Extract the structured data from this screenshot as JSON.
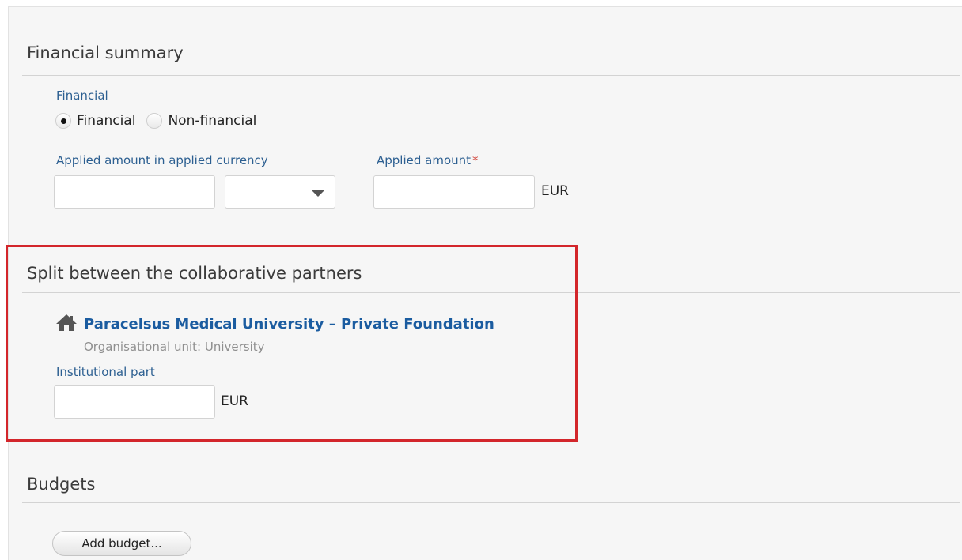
{
  "financial_summary": {
    "title": "Financial summary",
    "financial_label": "Financial",
    "radio_options": [
      {
        "label": "Financial",
        "selected": true
      },
      {
        "label": "Non-financial",
        "selected": false
      }
    ],
    "applied_currency_label": "Applied amount in applied currency",
    "applied_currency_value": "",
    "currency_select_value": "",
    "applied_amount_label": "Applied amount",
    "required_marker": "*",
    "applied_amount_value": "",
    "applied_amount_unit": "EUR"
  },
  "split": {
    "title": "Split between the collaborative partners",
    "organisation_name": "Paracelsus Medical University – Private Foundation",
    "organisation_icon": "home-icon",
    "organisational_unit": "Organisational unit: University",
    "institutional_part_label": "Institutional part",
    "institutional_part_value": "",
    "institutional_part_unit": "EUR",
    "highlight_color": "#d3262b"
  },
  "budgets": {
    "title": "Budgets",
    "add_button_label": "Add budget..."
  }
}
